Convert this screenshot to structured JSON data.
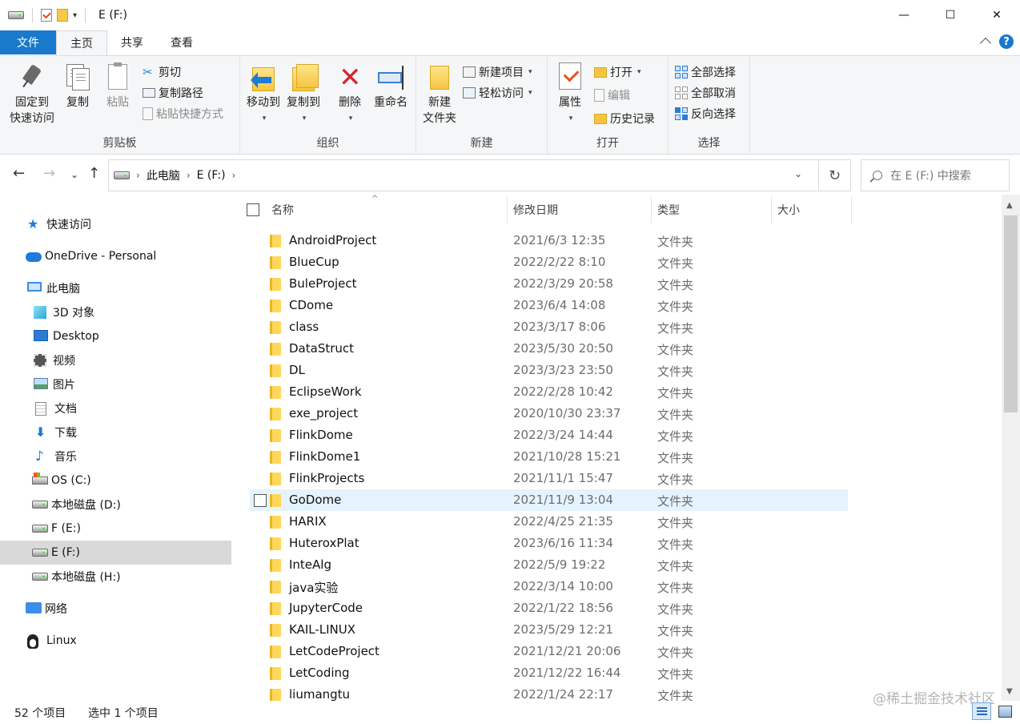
{
  "window": {
    "title": "E (F:)",
    "minimize": "—",
    "maximize": "☐",
    "close": "✕"
  },
  "tabs": [
    "文件",
    "主页",
    "共享",
    "查看"
  ],
  "ribbon": {
    "clipboard": {
      "label": "剪贴板",
      "pin_line1": "固定到",
      "pin_line2": "快速访问",
      "copy": "复制",
      "paste": "粘贴",
      "cut": "剪切",
      "copy_path": "复制路径",
      "paste_shortcut": "粘贴快捷方式"
    },
    "organize": {
      "label": "组织",
      "move_to": "移动到",
      "copy_to": "复制到",
      "delete": "删除",
      "rename": "重命名"
    },
    "new": {
      "label": "新建",
      "new_folder_line1": "新建",
      "new_folder_line2": "文件夹",
      "new_item": "新建项目",
      "easy_access": "轻松访问"
    },
    "open": {
      "label": "打开",
      "properties": "属性",
      "open": "打开",
      "edit": "编辑",
      "history": "历史记录"
    },
    "select": {
      "label": "选择",
      "select_all": "全部选择",
      "select_none": "全部取消",
      "invert": "反向选择"
    }
  },
  "address": {
    "crumbs": [
      "此电脑",
      "E (F:)"
    ],
    "search_placeholder": "在 E (F:) 中搜索"
  },
  "nav": {
    "quick_access": "快速访问",
    "onedrive": "OneDrive - Personal",
    "this_pc": "此电脑",
    "objects3d": "3D 对象",
    "desktop": "Desktop",
    "videos": "视频",
    "pictures": "图片",
    "documents": "文档",
    "downloads": "下载",
    "music": "音乐",
    "drive_c": "OS (C:)",
    "drive_d": "本地磁盘 (D:)",
    "drive_e": "F (E:)",
    "drive_f": "E (F:)",
    "drive_h": "本地磁盘 (H:)",
    "network": "网络",
    "linux": "Linux"
  },
  "columns": {
    "name": "名称",
    "date": "修改日期",
    "type": "类型",
    "size": "大小"
  },
  "files": [
    {
      "name": "AndroidProject",
      "date": "2021/6/3 12:35",
      "type": "文件夹"
    },
    {
      "name": "BlueCup",
      "date": "2022/2/22 8:10",
      "type": "文件夹"
    },
    {
      "name": "BuleProject",
      "date": "2022/3/29 20:58",
      "type": "文件夹"
    },
    {
      "name": "CDome",
      "date": "2023/6/4 14:08",
      "type": "文件夹"
    },
    {
      "name": "class",
      "date": "2023/3/17 8:06",
      "type": "文件夹"
    },
    {
      "name": "DataStruct",
      "date": "2023/5/30 20:50",
      "type": "文件夹"
    },
    {
      "name": "DL",
      "date": "2023/3/23 23:50",
      "type": "文件夹"
    },
    {
      "name": "EclipseWork",
      "date": "2022/2/28 10:42",
      "type": "文件夹"
    },
    {
      "name": "exe_project",
      "date": "2020/10/30 23:37",
      "type": "文件夹"
    },
    {
      "name": "FlinkDome",
      "date": "2022/3/24 14:44",
      "type": "文件夹"
    },
    {
      "name": "FlinkDome1",
      "date": "2021/10/28 15:21",
      "type": "文件夹"
    },
    {
      "name": "FlinkProjects",
      "date": "2021/11/1 15:47",
      "type": "文件夹"
    },
    {
      "name": "GoDome",
      "date": "2021/11/9 13:04",
      "type": "文件夹"
    },
    {
      "name": "HARIX",
      "date": "2022/4/25 21:35",
      "type": "文件夹"
    },
    {
      "name": "HuteroxPlat",
      "date": "2023/6/16 11:34",
      "type": "文件夹"
    },
    {
      "name": "InteAlg",
      "date": "2022/5/9 19:22",
      "type": "文件夹"
    },
    {
      "name": "java实验",
      "date": "2022/3/14 10:00",
      "type": "文件夹"
    },
    {
      "name": "JupyterCode",
      "date": "2022/1/22 18:56",
      "type": "文件夹"
    },
    {
      "name": "KAIL-LINUX",
      "date": "2023/5/29 12:21",
      "type": "文件夹"
    },
    {
      "name": "LetCodeProject",
      "date": "2021/12/21 20:06",
      "type": "文件夹"
    },
    {
      "name": "LetCoding",
      "date": "2021/12/22 16:44",
      "type": "文件夹"
    },
    {
      "name": "liumangtu",
      "date": "2022/1/24 22:17",
      "type": "文件夹"
    }
  ],
  "status": {
    "count": "52 个项目",
    "selected": "选中 1 个项目"
  },
  "watermark": "@稀土掘金技术社区"
}
